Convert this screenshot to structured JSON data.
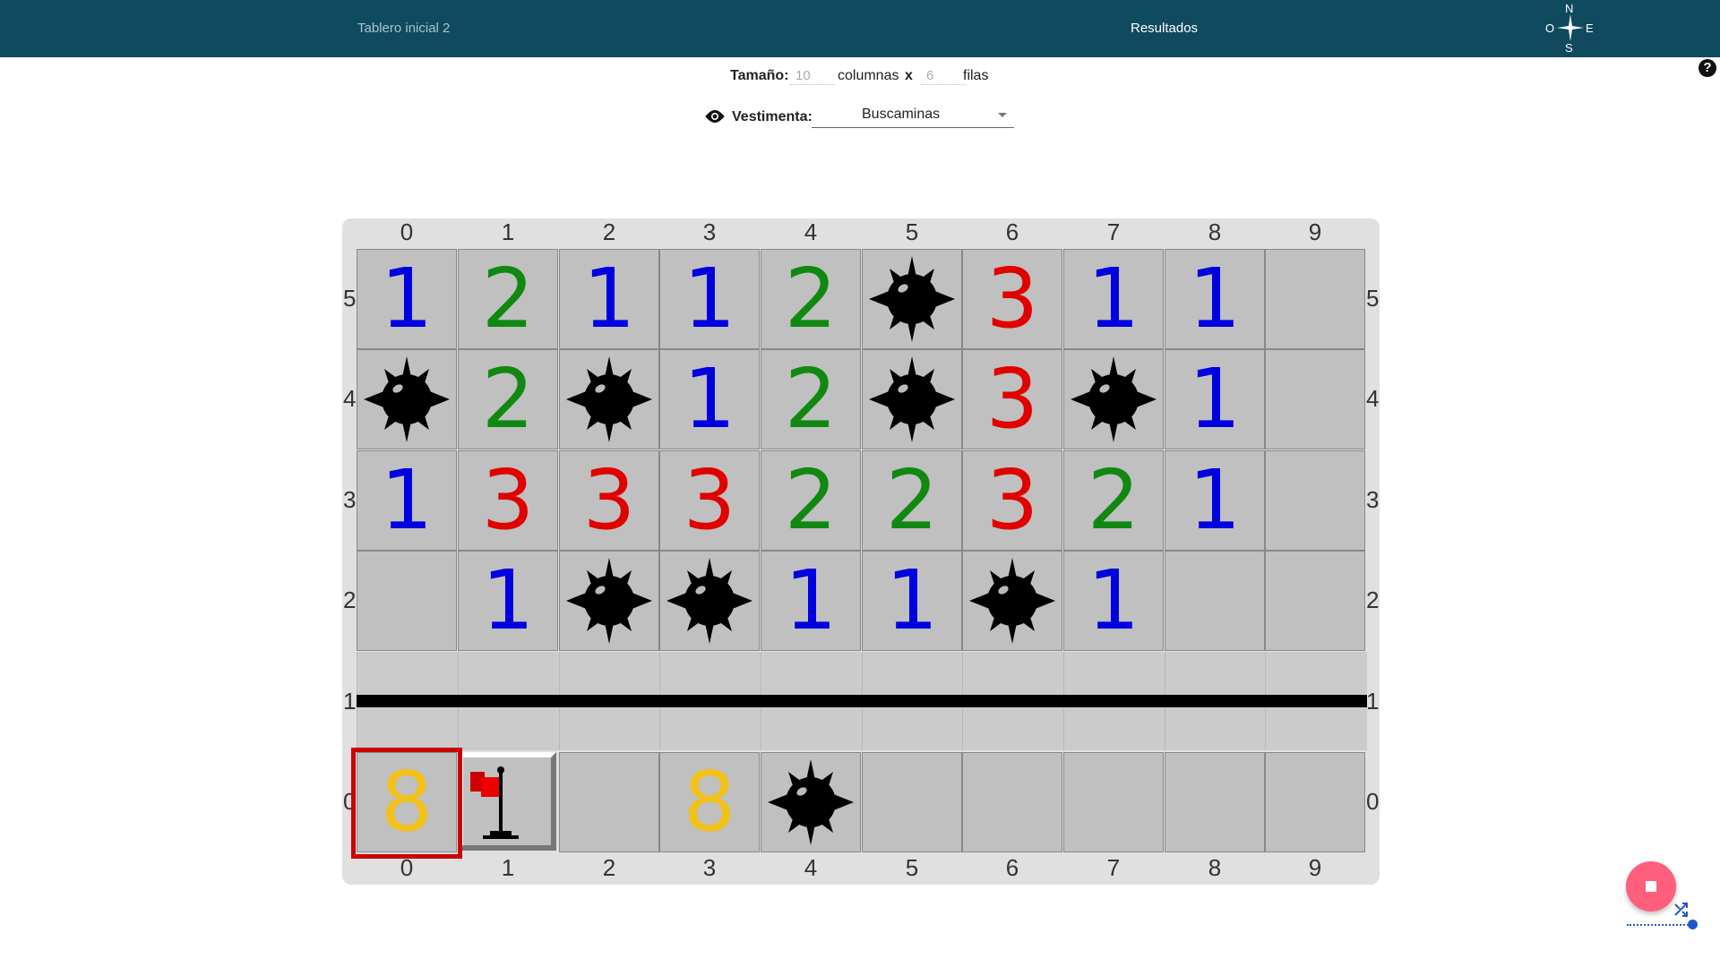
{
  "topbar": {
    "tab_board": "Tablero inicial 2",
    "tab_results": "Resultados",
    "compass": {
      "n": "N",
      "s": "S",
      "o": "O",
      "e": "E"
    }
  },
  "size": {
    "label": "Tamaño:",
    "columns_value": "10",
    "columns_label": "columnas",
    "x_label": "x",
    "rows_value": "6",
    "rows_label": "filas"
  },
  "outfit": {
    "label": "Vestimenta:",
    "value": "Buscaminas"
  },
  "help_label": "?",
  "board": {
    "columns": [
      "0",
      "1",
      "2",
      "3",
      "4",
      "5",
      "6",
      "7",
      "8",
      "9"
    ],
    "rows": [
      "5",
      "4",
      "3",
      "2",
      "1",
      "0"
    ],
    "cells": {
      "r5": [
        "1",
        "2",
        "1",
        "1",
        "2",
        "mine",
        "3",
        "1",
        "1",
        ""
      ],
      "r4": [
        "mine",
        "2",
        "mine",
        "1",
        "2",
        "mine",
        "3",
        "mine",
        "1",
        ""
      ],
      "r3": [
        "1",
        "3",
        "3",
        "3",
        "2",
        "2",
        "3",
        "2",
        "1",
        ""
      ],
      "r2": [
        "",
        "1",
        "mine",
        "mine",
        "1",
        "1",
        "mine",
        "1",
        "",
        ""
      ],
      "r1": "wall",
      "r0": [
        "8",
        "flag",
        "",
        "8",
        "mine",
        "",
        "",
        "",
        "",
        ""
      ]
    },
    "cursor": {
      "row": "0",
      "col": "0"
    }
  },
  "colors": {
    "topbar": "#0f4a5f",
    "num1": "#0000e0",
    "num2": "#118811",
    "num3": "#e00000",
    "num8": "#f2c21a",
    "cursor": "#cc0000",
    "fab": "#ff5f7c"
  },
  "icons": [
    "compass-icon",
    "help-icon",
    "eye-icon",
    "mine-icon",
    "flag-icon",
    "stop-icon",
    "shuffle-icon"
  ]
}
